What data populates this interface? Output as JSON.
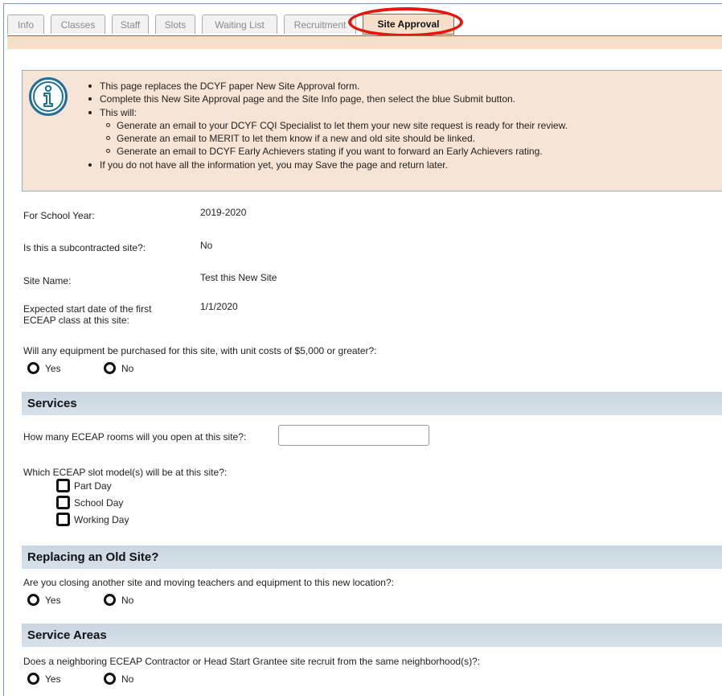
{
  "tabs": [
    {
      "label": "Info",
      "active": false
    },
    {
      "label": "Classes",
      "active": false
    },
    {
      "label": "Staff",
      "active": false
    },
    {
      "label": "Slots",
      "active": false
    },
    {
      "label": "Waiting List",
      "active": false
    },
    {
      "label": "Recruitment",
      "active": false
    },
    {
      "label": "Site Approval",
      "active": true
    }
  ],
  "info": {
    "icon": "info-circle-icon",
    "items": [
      "This page replaces the DCYF paper New Site Approval form.",
      "Complete this New Site Approval page and the Site Info page, then select the blue Submit button.",
      "This will:",
      "Generate an email to your DCYF CQI Specialist to let them your new site request is ready for their review.",
      "Generate an email to MERIT to let them know if a new and old site should be linked.",
      "Generate an email to DCYF Early Achievers stating if you want to forward an Early Achievers rating.",
      "If you do not have all the information yet, you may Save the page and return later."
    ]
  },
  "fields": {
    "school_year_label": "For School Year:",
    "school_year_value": "2019-2020",
    "subcontracted_label": "Is this a subcontracted site?:",
    "subcontracted_value": "No",
    "site_name_label": "Site Name:",
    "site_name_value": "Test this New Site",
    "start_date_label_1": "Expected start date of the first",
    "start_date_label_2": "ECEAP class at this site:",
    "start_date_value": "1/1/2020",
    "equipment_question": "Will any equipment be purchased for this site, with unit costs of $5,000 or greater?:"
  },
  "radio": {
    "yes": "Yes",
    "no": "No"
  },
  "services": {
    "heading": "Services",
    "rooms_question": "How many ECEAP rooms will you open at this site?:",
    "rooms_value": "",
    "slot_question": "Which ECEAP slot model(s) will be at this site?:",
    "slot_options": [
      "Part Day",
      "School Day",
      "Working Day"
    ]
  },
  "replacing": {
    "heading": "Replacing an Old Site?",
    "question": "Are you closing another site and moving teachers and equipment to this new location?:"
  },
  "service_areas": {
    "heading": "Service Areas",
    "question": "Does a neighboring ECEAP Contractor or Head Start Grantee site recruit from the same neighborhood(s)?:"
  },
  "colors": {
    "accent_tab": "#f6dfc9",
    "highlight": "#e8140e",
    "section_bg": "#d0dbe4"
  }
}
